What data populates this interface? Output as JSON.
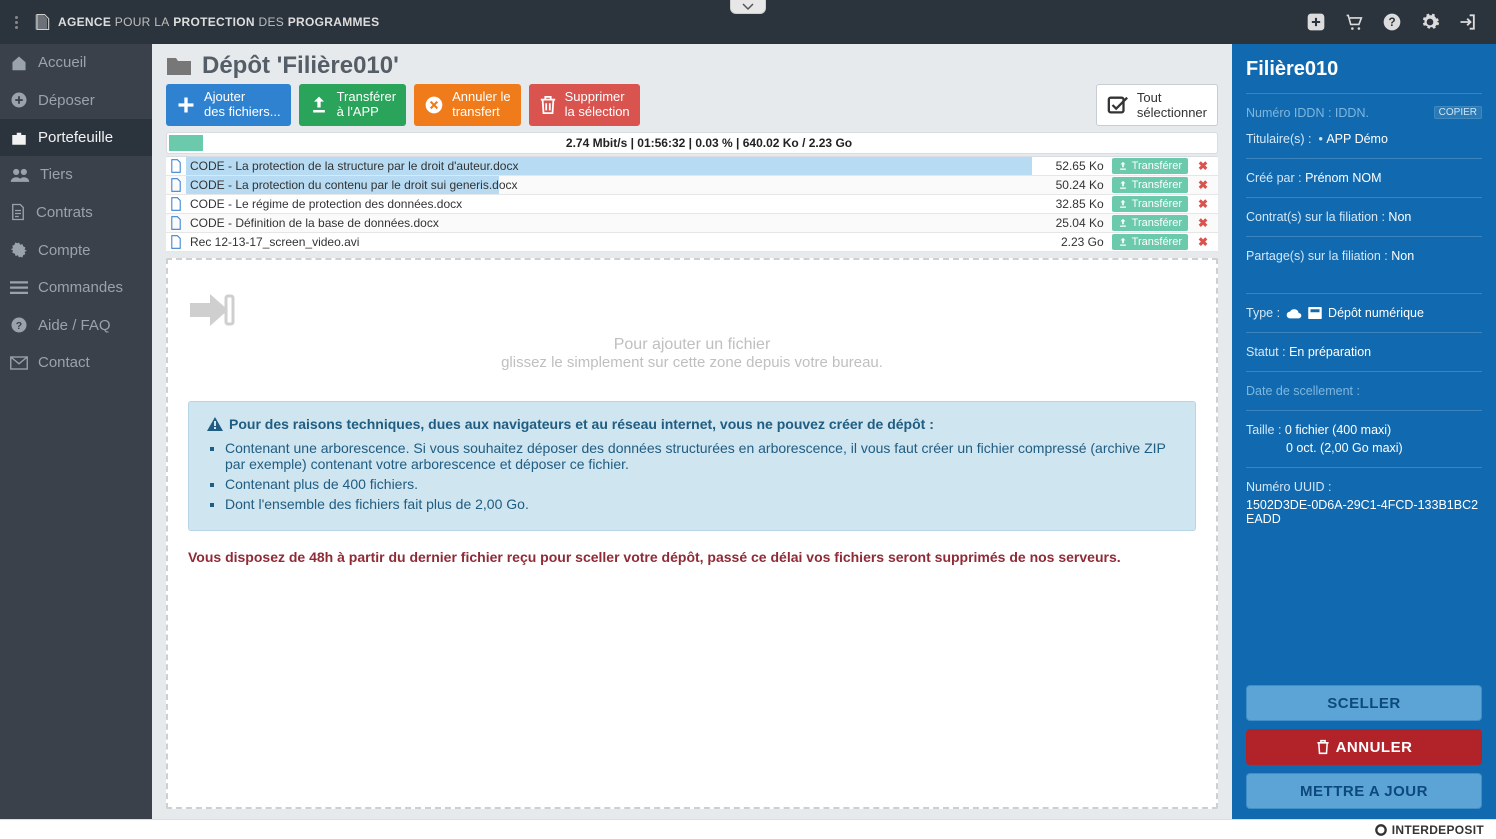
{
  "brand": {
    "name_bold": "AGENCE",
    "name_mid": "POUR LA",
    "name_bold2": "PROTECTION",
    "name_mid2": "DES",
    "name_bold3": "PROGRAMMES"
  },
  "sidebar": {
    "items": [
      {
        "label": "Accueil"
      },
      {
        "label": "Déposer"
      },
      {
        "label": "Portefeuille"
      },
      {
        "label": "Tiers"
      },
      {
        "label": "Contrats"
      },
      {
        "label": "Compte"
      },
      {
        "label": "Commandes"
      },
      {
        "label": "Aide / FAQ"
      },
      {
        "label": "Contact"
      }
    ]
  },
  "heading": "Dépôt 'Filière010'",
  "toolbar": {
    "add": {
      "l1": "Ajouter",
      "l2": "des fichiers..."
    },
    "transfer": {
      "l1": "Transférer",
      "l2": "à l'APP"
    },
    "cancel": {
      "l1": "Annuler le",
      "l2": "transfert"
    },
    "delete": {
      "l1": "Supprimer",
      "l2": "la sélection"
    },
    "selectall": {
      "l1": "Tout",
      "l2": "sélectionner"
    }
  },
  "status": "2.74 Mbit/s | 01:56:32 | 0.03 % | 640.02 Ko / 2.23 Go",
  "files": [
    {
      "name": "CODE - La protection de la structure par le droit d'auteur.docx",
      "size": "52.65 Ko",
      "btn": "Transférer",
      "progress": 100
    },
    {
      "name": "CODE - La protection du contenu par le droit sui generis.docx",
      "size": "50.24 Ko",
      "btn": "Transférer",
      "progress": 37
    },
    {
      "name": "CODE - Le régime de protection des données.docx",
      "size": "32.85 Ko",
      "btn": "Transférer",
      "progress": 0
    },
    {
      "name": "CODE - Définition de la base de données.docx",
      "size": "25.04 Ko",
      "btn": "Transférer",
      "progress": 0
    },
    {
      "name": "Rec 12-13-17_screen_video.avi",
      "size": "2.23 Go",
      "btn": "Transférer",
      "progress": 0
    }
  ],
  "drop": {
    "hint1": "Pour ajouter un fichier",
    "hint2": "glissez le simplement sur cette zone depuis votre bureau."
  },
  "alert": {
    "title": "Pour des raisons techniques, dues aux navigateurs et au réseau internet, vous ne pouvez créer de dépôt :",
    "items": [
      "Contenant une arborescence. Si vous souhaitez déposer des données structurées en arborescence, il vous faut créer un fichier compressé (archive ZIP par exemple) contenant votre arborescence et déposer ce fichier.",
      "Contenant plus de 400 fichiers.",
      "Dont l'ensemble des fichiers fait plus de 2,00 Go."
    ]
  },
  "warn": "Vous disposez de 48h à partir du dernier fichier reçu pour sceller votre dépôt, passé ce délai vos fichiers seront supprimés de nos serveurs.",
  "panel": {
    "title": "Filière010",
    "iddn_label": "Numéro IDDN :",
    "iddn_value": "IDDN.",
    "copy": "COPIER",
    "owner_label": "Titulaire(s) :",
    "owner_value": "APP Démo",
    "created_label": "Créé par :",
    "created_value": "Prénom NOM",
    "contract_label": "Contrat(s) sur la filiation :",
    "contract_value": "Non",
    "share_label": "Partage(s) sur la filiation :",
    "share_value": "Non",
    "type_label": "Type :",
    "type_value": "Dépôt numérique",
    "status_label": "Statut :",
    "status_value": "En préparation",
    "seal_label": "Date de scellement :",
    "size_label": "Taille :",
    "size_l1": "0 fichier (400 maxi)",
    "size_l2": "0 oct. (2,00 Go maxi)",
    "uuid_label": "Numéro UUID :",
    "uuid_value": "1502D3DE-0D6A-29C1-4FCD-133B1BC2EADD",
    "btn_seal": "SCELLER",
    "btn_cancel": "ANNULER",
    "btn_save": "METTRE A JOUR"
  },
  "footer": {
    "brand": "INTERDEPOSIT"
  }
}
